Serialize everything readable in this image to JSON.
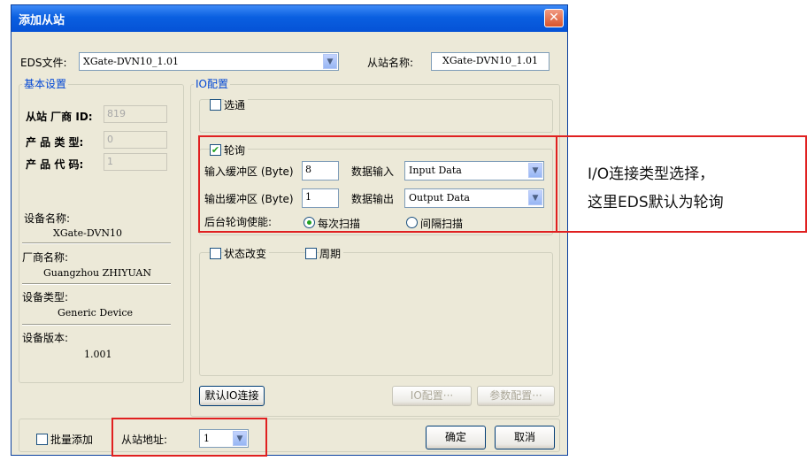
{
  "dialog": {
    "title": "添加从站",
    "close_glyph": "✕",
    "eds_label": "EDS文件:",
    "eds_value": "XGate-DVN10_1.01",
    "slave_name_label": "从站名称:",
    "slave_name_value": "XGate-DVN10_1.01"
  },
  "basic": {
    "group_title": "基本设置",
    "vendor_id_label": "从站 厂商 ID:",
    "vendor_id_value": "819",
    "product_type_label": "产 品  类 型:",
    "product_type_value": "0",
    "product_code_label": "产 品  代 码:",
    "product_code_value": "1",
    "device_name_label": "设备名称:",
    "device_name_value": "XGate-DVN10",
    "vendor_name_label": "厂商名称:",
    "vendor_name_value": "Guangzhou ZHIYUAN",
    "device_type_label": "设备类型:",
    "device_type_value": "Generic Device",
    "device_version_label": "设备版本:",
    "device_version_value": "1.001"
  },
  "io": {
    "group_title": "IO配置",
    "strobe_label": "选通",
    "strobe_checked": false,
    "poll_label": "轮询",
    "poll_checked": true,
    "input_buffer_label": "输入缓冲区 (Byte)",
    "input_buffer_value": "8",
    "data_input_label": "数据输入",
    "data_input_value": "Input Data",
    "output_buffer_label": "输出缓冲区 (Byte)",
    "output_buffer_value": "1",
    "data_output_label": "数据输出",
    "data_output_value": "Output Data",
    "background_poll_label": "后台轮询使能:",
    "every_scan_label": "每次扫描",
    "interval_scan_label": "间隔扫描",
    "cos_label": "状态改变",
    "cyclic_label": "周期",
    "default_io_button": "默认IO连接",
    "io_config_button": "IO配置···",
    "param_config_button": "参数配置···"
  },
  "footer": {
    "batch_add_label": "批量添加",
    "slave_address_label": "从站地址:",
    "slave_address_value": "1",
    "ok_button": "确定",
    "cancel_button": "取消"
  },
  "annotation": {
    "line1": "I/O连接类型选择，",
    "line2": "这里EDS默认为轮询"
  },
  "colors": {
    "titlebar": "#0a5fe0",
    "highlight": "#e02020",
    "group_title": "#0046d5"
  }
}
